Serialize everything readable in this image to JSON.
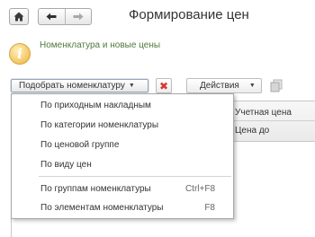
{
  "header": {
    "title": "Формирование цен",
    "home_icon": "home-icon",
    "back_icon": "arrow-left-icon",
    "forward_icon": "arrow-right-icon"
  },
  "info": {
    "icon": "info-icon",
    "icon_glyph": "i",
    "text": "Номенклатура и новые цены"
  },
  "toolbar": {
    "select_label": "Подобрать номенклатуру",
    "select_caret": "▼",
    "delete_glyph": "✖",
    "actions_label": "Действия",
    "actions_caret": "▼",
    "copy_icon": "copy-icon"
  },
  "table": {
    "columns": [
      "Учетная цена",
      "Цена до"
    ]
  },
  "menu": {
    "items": [
      {
        "label": "По приходным накладным",
        "shortcut": ""
      },
      {
        "label": "По категории номенклатуры",
        "shortcut": ""
      },
      {
        "label": "По ценовой группе",
        "shortcut": ""
      },
      {
        "label": "По виду цен",
        "shortcut": ""
      },
      {
        "label": "По группам номенклатуры",
        "shortcut": "Ctrl+F8"
      },
      {
        "label": "По элементам номенклатуры",
        "shortcut": "F8"
      }
    ]
  },
  "colors": {
    "info_text": "#4d7a3a",
    "delete_red": "#d23b2f",
    "info_icon": "#f2c560"
  }
}
